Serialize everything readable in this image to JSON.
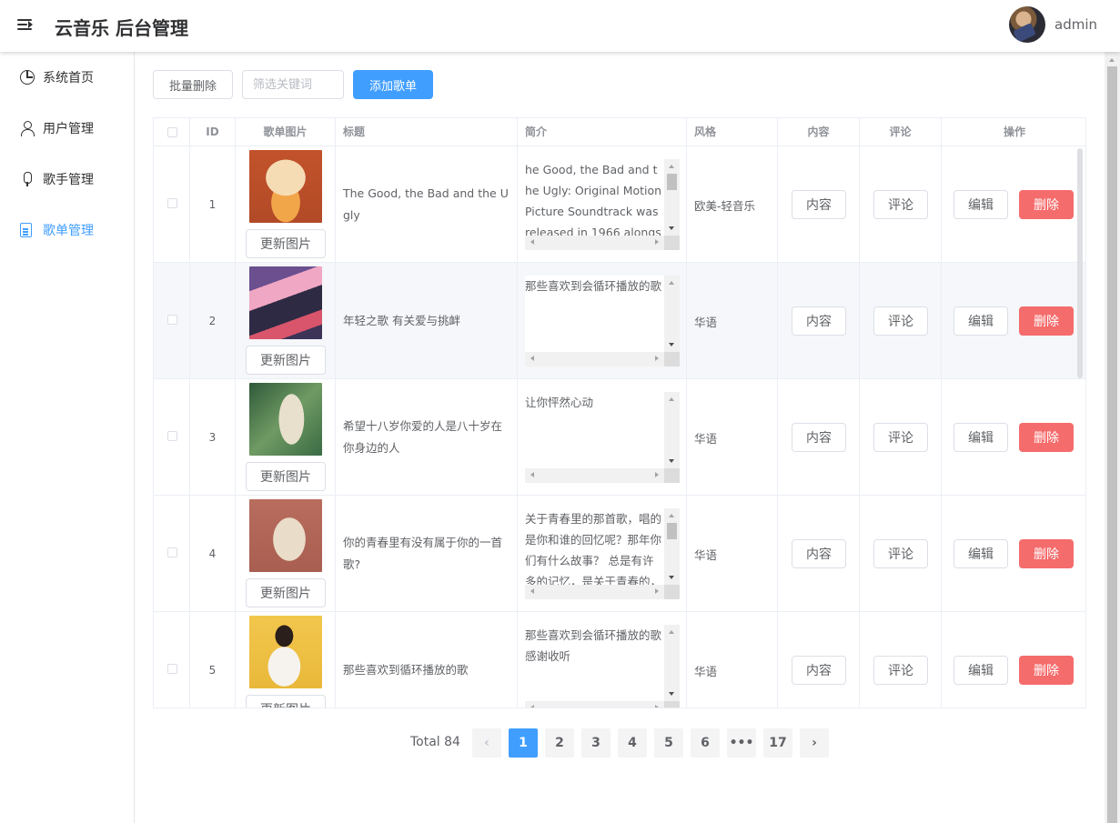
{
  "header": {
    "title": "云音乐 后台管理",
    "username": "admin"
  },
  "sidebar": {
    "items": [
      {
        "label": "系统首页",
        "icon": "pie-chart-icon"
      },
      {
        "label": "用户管理",
        "icon": "user-icon"
      },
      {
        "label": "歌手管理",
        "icon": "microphone-icon"
      },
      {
        "label": "歌单管理",
        "icon": "document-icon",
        "active": true
      }
    ]
  },
  "toolbar": {
    "batch_delete_label": "批量删除",
    "search_placeholder": "筛选关键词",
    "add_label": "添加歌单"
  },
  "table": {
    "headers": {
      "id": "ID",
      "cover": "歌单图片",
      "title": "标题",
      "intro": "简介",
      "style": "风格",
      "content": "内容",
      "comment": "评论",
      "actions": "操作"
    },
    "update_cover_label": "更新图片",
    "content_label": "内容",
    "comment_label": "评论",
    "edit_label": "编辑",
    "delete_label": "删除",
    "rows": [
      {
        "id": "1",
        "title": "The Good, the Bad and the Ugly",
        "intro": "he Good, the Bad and the Ugly: Original Motion Picture Soundtrack was released in 1966 alongside the",
        "style": "欧美-轻音乐"
      },
      {
        "id": "2",
        "title": "年轻之歌 有关爱与挑衅",
        "intro": "那些喜欢到会循环播放的歌",
        "style": "华语"
      },
      {
        "id": "3",
        "title": "希望十八岁你爱的人是八十岁在你身边的人",
        "intro": "让你怦然心动",
        "style": "华语"
      },
      {
        "id": "4",
        "title": "你的青春里有没有属于你的一首歌?",
        "intro": "关于青春里的那首歌，唱的是你和谁的回忆呢？那年你们有什么故事？ 总是有许多的记忆，是关于青春的，青",
        "style": "华语"
      },
      {
        "id": "5",
        "title": "那些喜欢到循环播放的歌",
        "intro": "那些喜欢到会循环播放的歌 感谢收听",
        "style": "华语"
      }
    ]
  },
  "pagination": {
    "total": "Total 84",
    "pages": [
      "1",
      "2",
      "3",
      "4",
      "5",
      "6",
      "•••",
      "17"
    ],
    "current": "1"
  },
  "colors": {
    "primary": "#409eff",
    "danger": "#f56c6c",
    "border": "#ebeef5",
    "row_hover": "#f5f7fa"
  }
}
